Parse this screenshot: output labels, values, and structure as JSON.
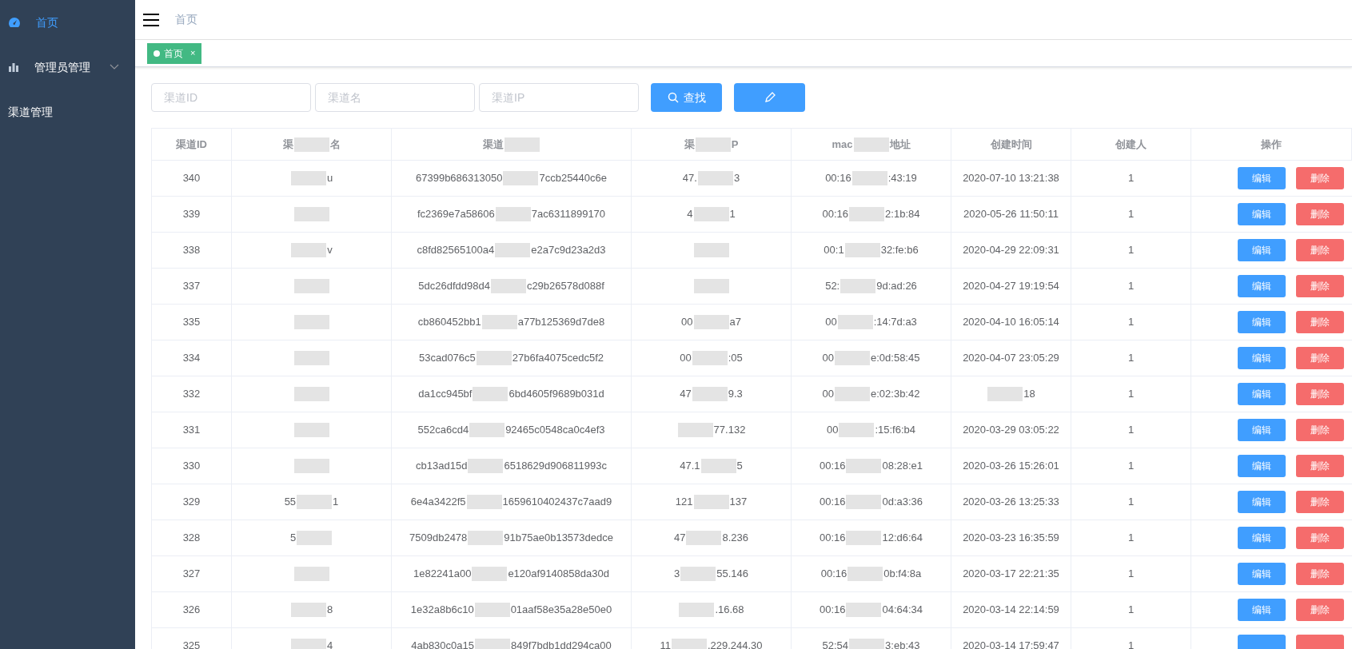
{
  "sidebar": {
    "items": [
      {
        "kind": "home",
        "label": "首页",
        "selected": true
      },
      {
        "kind": "group",
        "label": "管理员管理",
        "selected": false
      },
      {
        "kind": "plain",
        "label": "渠道管理",
        "selected": false
      }
    ]
  },
  "header": {
    "breadcrumb": "首页"
  },
  "tags": [
    {
      "label": "首页",
      "selected": true,
      "close": "×"
    }
  ],
  "search": {
    "fields": [
      {
        "placeholder": "渠道ID"
      },
      {
        "placeholder": "渠道名"
      },
      {
        "placeholder": "渠道IP"
      }
    ],
    "buttons": [
      {
        "kind": "search",
        "label": "查找"
      },
      {
        "kind": "add"
      }
    ]
  },
  "table": {
    "columns": [
      "渠道ID",
      {
        "before": "渠",
        "after": "名"
      },
      {
        "before": "渠道"
      },
      {
        "before": "渠",
        "after": "P"
      },
      {
        "before": "mac",
        "after": "地址"
      },
      "创建时间",
      "创建人",
      "操作"
    ],
    "rows": [
      {
        "cells": [
          "340",
          {
            "after": "u"
          },
          {
            "before": "67399b686313050",
            "after": "7ccb25440c6e"
          },
          {
            "before": "47.",
            "after": "3"
          },
          {
            "before": "00:16",
            "after": ":43:19"
          },
          "2020-07-10 13:21:38",
          "1"
        ],
        "actions": [
          {
            "kind": "edit",
            "label": "编辑"
          },
          {
            "kind": "delete",
            "label": "删除"
          }
        ]
      },
      {
        "cells": [
          "339",
          {},
          {
            "before": "fc2369e7a58606",
            "after": "7ac6311899170"
          },
          {
            "before": "4",
            "after": "1"
          },
          {
            "before": "00:16",
            "after": "2:1b:84"
          },
          "2020-05-26 11:50:11",
          "1"
        ],
        "actions": [
          {
            "kind": "edit",
            "label": "编辑"
          },
          {
            "kind": "delete",
            "label": "删除"
          }
        ]
      },
      {
        "cells": [
          "338",
          {
            "after": "v"
          },
          {
            "before": "c8fd82565100a4",
            "after": "e2a7c9d23a2d3"
          },
          {},
          {
            "before": "00:1",
            "after": "32:fe:b6"
          },
          "2020-04-29 22:09:31",
          "1"
        ],
        "actions": [
          {
            "kind": "edit",
            "label": "编辑"
          },
          {
            "kind": "delete",
            "label": "删除"
          }
        ]
      },
      {
        "cells": [
          "337",
          {},
          {
            "before": "5dc26dfdd98d4",
            "after": "c29b26578d088f"
          },
          {},
          {
            "before": "52:",
            "after": "9d:ad:26"
          },
          "2020-04-27 19:19:54",
          "1"
        ],
        "actions": [
          {
            "kind": "edit",
            "label": "编辑"
          },
          {
            "kind": "delete",
            "label": "删除"
          }
        ]
      },
      {
        "cells": [
          "335",
          {},
          {
            "before": "cb860452bb1",
            "after": "a77b125369d7de8"
          },
          {
            "before": "00",
            "after": "a7"
          },
          {
            "before": "00",
            "after": ":14:7d:a3"
          },
          "2020-04-10 16:05:14",
          "1"
        ],
        "actions": [
          {
            "kind": "edit",
            "label": "编辑"
          },
          {
            "kind": "delete",
            "label": "删除"
          }
        ]
      },
      {
        "cells": [
          "334",
          {},
          {
            "before": "53cad076c5",
            "after": "27b6fa4075cedc5f2"
          },
          {
            "before": "00",
            "after": ":05"
          },
          {
            "before": "00",
            "after": "e:0d:58:45"
          },
          "2020-04-07 23:05:29",
          "1"
        ],
        "actions": [
          {
            "kind": "edit",
            "label": "编辑"
          },
          {
            "kind": "delete",
            "label": "删除"
          }
        ]
      },
      {
        "cells": [
          "332",
          {},
          {
            "before": "da1cc945bf",
            "after": "6bd4605f9689b031d"
          },
          {
            "before": "47",
            "after": "9.3"
          },
          {
            "before": "00",
            "after": "e:02:3b:42"
          },
          {
            "after": "18"
          },
          "1"
        ],
        "actions": [
          {
            "kind": "edit",
            "label": "编辑"
          },
          {
            "kind": "delete",
            "label": "删除"
          }
        ]
      },
      {
        "cells": [
          "331",
          {},
          {
            "before": "552ca6cd4",
            "after": "92465c0548ca0c4ef3"
          },
          {
            "after": "77.132"
          },
          {
            "before": "00",
            "after": ":15:f6:b4"
          },
          "2020-03-29 03:05:22",
          "1"
        ],
        "actions": [
          {
            "kind": "edit",
            "label": "编辑"
          },
          {
            "kind": "delete",
            "label": "删除"
          }
        ]
      },
      {
        "cells": [
          "330",
          {},
          {
            "before": "cb13ad15d",
            "after": "6518629d906811993c"
          },
          {
            "before": "47.1",
            "after": "5"
          },
          {
            "before": "00:16",
            "after": "08:28:e1"
          },
          "2020-03-26 15:26:01",
          "1"
        ],
        "actions": [
          {
            "kind": "edit",
            "label": "编辑"
          },
          {
            "kind": "delete",
            "label": "删除"
          }
        ]
      },
      {
        "cells": [
          "329",
          {
            "before": "55",
            "after": "1"
          },
          {
            "before": "6e4a3422f5",
            "after": "1659610402437c7aad9"
          },
          {
            "before": "121",
            "after": "137"
          },
          {
            "before": "00:16",
            "after": "0d:a3:36"
          },
          "2020-03-26 13:25:33",
          "1"
        ],
        "actions": [
          {
            "kind": "edit",
            "label": "编辑"
          },
          {
            "kind": "delete",
            "label": "删除"
          }
        ]
      },
      {
        "cells": [
          "328",
          {
            "before": "5"
          },
          {
            "before": "7509db2478",
            "after": "91b75ae0b13573dedce"
          },
          {
            "before": "47",
            "after": "8.236"
          },
          {
            "before": "00:16",
            "after": "12:d6:64"
          },
          "2020-03-23 16:35:59",
          "1"
        ],
        "actions": [
          {
            "kind": "edit",
            "label": "编辑"
          },
          {
            "kind": "delete",
            "label": "删除"
          }
        ]
      },
      {
        "cells": [
          "327",
          {},
          {
            "before": "1e82241a00",
            "after": "e120af9140858da30d"
          },
          {
            "before": "3",
            "after": "55.146"
          },
          {
            "before": "00:16",
            "after": "0b:f4:8a"
          },
          "2020-03-17 22:21:35",
          "1"
        ],
        "actions": [
          {
            "kind": "edit",
            "label": "编辑"
          },
          {
            "kind": "delete",
            "label": "删除"
          }
        ]
      },
      {
        "cells": [
          "326",
          {
            "after": "8"
          },
          {
            "before": "1e32a8b6c10",
            "after": "01aaf58e35a28e50e0"
          },
          {
            "after": ".16.68"
          },
          {
            "before": "00:16",
            "after": "04:64:34"
          },
          "2020-03-14 22:14:59",
          "1"
        ],
        "actions": [
          {
            "kind": "edit",
            "label": "编辑"
          },
          {
            "kind": "delete",
            "label": "删除"
          }
        ]
      },
      {
        "cells": [
          "325",
          {
            "after": "4"
          },
          {
            "before": "4ab830c0a15",
            "after": "849f7bdb1dd294ca00"
          },
          {
            "before": "11",
            "after": ".229.244.30"
          },
          {
            "before": "52:54",
            "after": "3:eb:43"
          },
          "2020-03-14 17:59:47",
          "1"
        ],
        "actions": [
          {
            "kind": "edit"
          },
          {
            "kind": "delete"
          }
        ]
      }
    ]
  }
}
